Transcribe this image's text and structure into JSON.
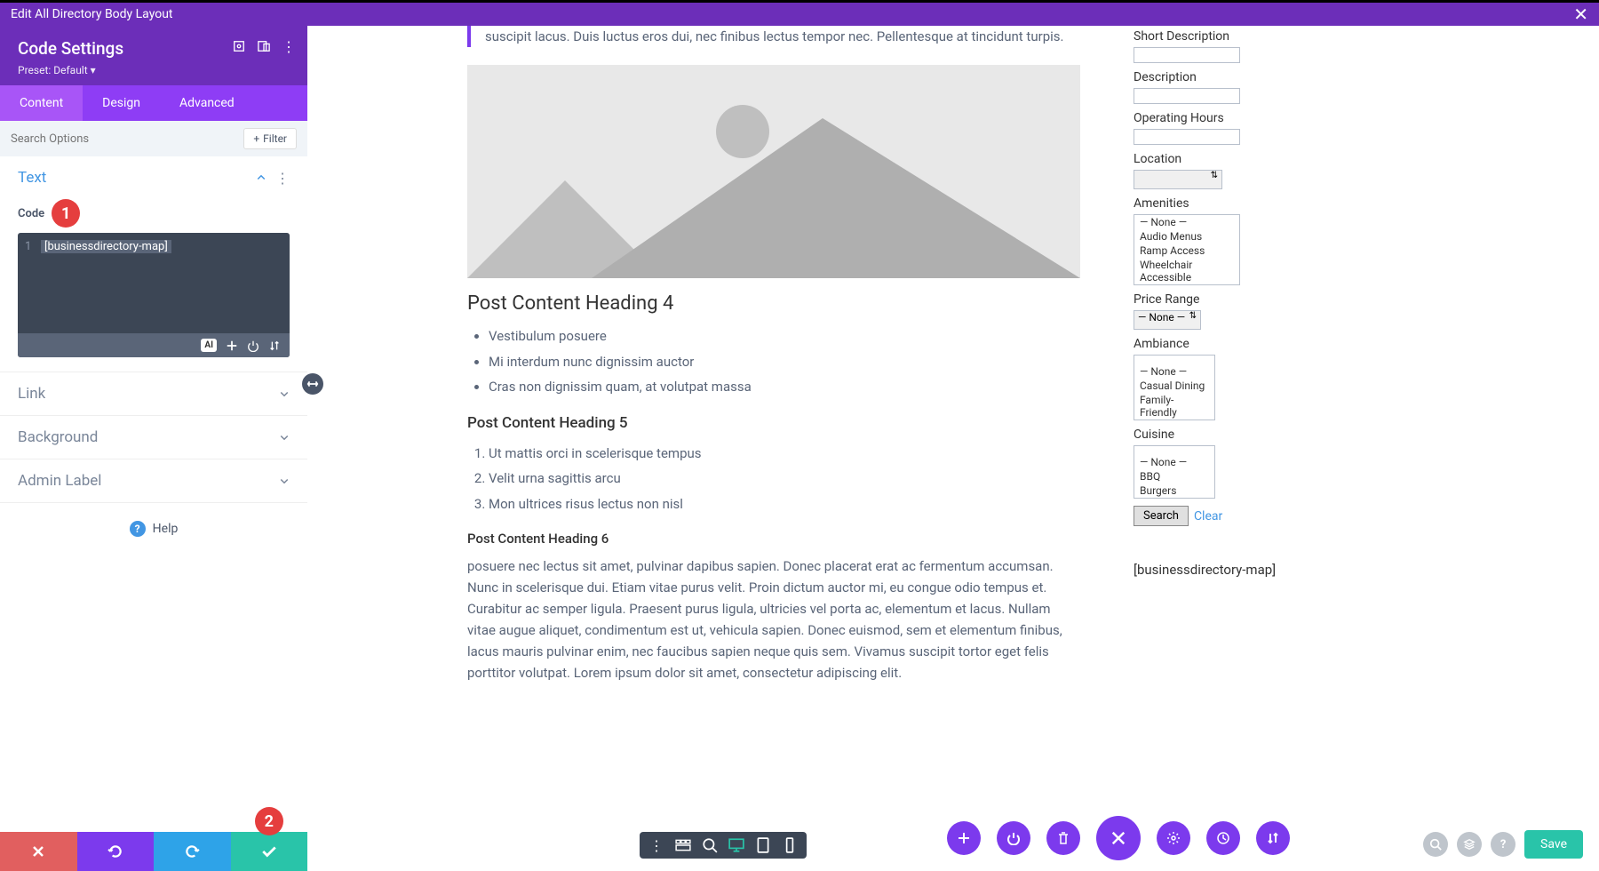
{
  "header": {
    "title": "Edit All Directory Body Layout"
  },
  "sidebar": {
    "title": "Code Settings",
    "preset": "Preset: Default ▾",
    "tabs": {
      "content": "Content",
      "design": "Design",
      "advanced": "Advanced"
    },
    "search_placeholder": "Search Options",
    "filter": "Filter",
    "sections": {
      "text": "Text",
      "code_label": "Code",
      "code_value": "[businessdirectory-map]",
      "link": "Link",
      "background": "Background",
      "admin_label": "Admin Label"
    },
    "help": "Help"
  },
  "post": {
    "quote": "suscipit lacus. Duis luctus eros dui, nec finibus lectus tempor nec. Pellentesque at tincidunt turpis.",
    "h4": "Post Content Heading 4",
    "ul": [
      "Vestibulum posuere",
      "Mi interdum nunc dignissim auctor",
      "Cras non dignissim quam, at volutpat massa"
    ],
    "h5": "Post Content Heading 5",
    "ol": [
      "Ut mattis orci in scelerisque tempus",
      "Velit urna sagittis arcu",
      "Mon ultrices risus lectus non nisl"
    ],
    "h6": "Post Content Heading 6",
    "body": "posuere nec lectus sit amet, pulvinar dapibus sapien. Donec placerat erat ac fermentum accumsan. Nunc in scelerisque dui. Etiam vitae purus velit. Proin dictum auctor mi, eu congue odio tempus et. Curabitur ac semper ligula. Praesent purus ligula, ultricies vel porta ac, elementum et lacus. Nullam vitae augue aliquet, condimentum est ut, vehicula sapien. Donec euismod, sem et elementum finibus, lacus mauris pulvinar enim, nec faucibus sapien neque quis sem. Vivamus suscipit tortor eget felis porttitor volutpat. Lorem ipsum dolor sit amet, consectetur adipiscing elit."
  },
  "form": {
    "short_desc": "Short Description",
    "description": "Description",
    "operating": "Operating Hours",
    "location": "Location",
    "amenities": "Amenities",
    "amenities_opts": [
      "— None —",
      "Audio Menus",
      "Ramp Access",
      "Wheelchair Accessible"
    ],
    "price_range": "Price Range",
    "price_sel": "— None —",
    "ambiance": "Ambiance",
    "ambiance_opts": [
      "— None —",
      "Casual Dining",
      "Family-Friendly"
    ],
    "cuisine": "Cuisine",
    "cuisine_opts": [
      "— None —",
      "BBQ",
      "Burgers"
    ],
    "search": "Search",
    "clear": "Clear",
    "map": "[businessdirectory-map]"
  },
  "save": "Save",
  "badges": {
    "one": "1",
    "two": "2"
  }
}
